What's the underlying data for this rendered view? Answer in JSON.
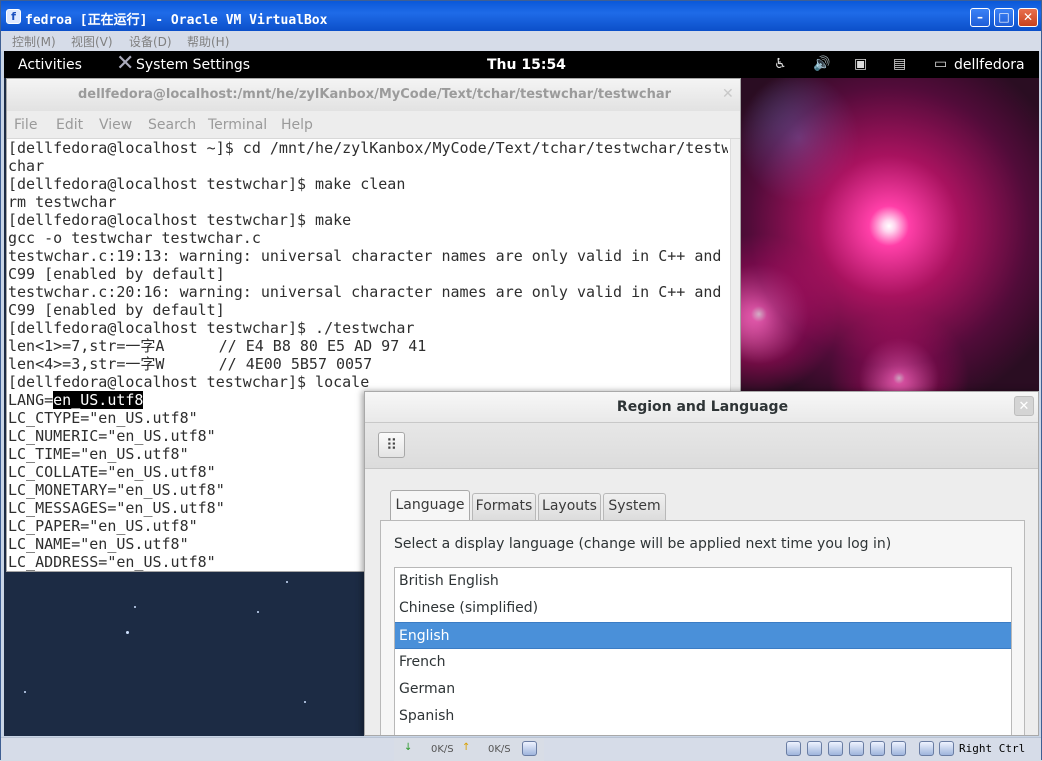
{
  "vbox": {
    "title": "fedroa [正在运行] - Oracle VM VirtualBox",
    "menu": [
      "控制(M)",
      "视图(V)",
      "设备(D)",
      "帮助(H)"
    ],
    "status": {
      "down_rate": "0K/S",
      "up_rate": "0K/S",
      "host_key": "Right Ctrl"
    }
  },
  "gnome": {
    "activities": "Activities",
    "app_menu": "System Settings",
    "clock": "Thu 15:54",
    "user": "dellfedora"
  },
  "terminal": {
    "title": "dellfedora@localhost:/mnt/he/zylKanbox/MyCode/Text/tchar/testwchar/testwchar",
    "menu": [
      "File",
      "Edit",
      "View",
      "Search",
      "Terminal",
      "Help"
    ],
    "lines": [
      "[dellfedora@localhost ~]$ cd /mnt/he/zylKanbox/MyCode/Text/tchar/testwchar/testw",
      "char",
      "[dellfedora@localhost testwchar]$ make clean",
      "rm testwchar",
      "[dellfedora@localhost testwchar]$ make",
      "gcc -o testwchar testwchar.c",
      "testwchar.c:19:13: warning: universal character names are only valid in C++ and",
      "C99 [enabled by default]",
      "testwchar.c:20:16: warning: universal character names are only valid in C++ and",
      "C99 [enabled by default]",
      "[dellfedora@localhost testwchar]$ ./testwchar",
      "len<1>=7,str=一字A      // E4 B8 80 E5 AD 97 41",
      "len<4>=3,str=一字W      // 4E00 5B57 0057",
      "[dellfedora@localhost testwchar]$ locale"
    ],
    "lang_prefix": "LANG=",
    "lang_value": "en_US.utf8",
    "locale_lines": [
      "LC_CTYPE=\"en_US.utf8\"",
      "LC_NUMERIC=\"en_US.utf8\"",
      "LC_TIME=\"en_US.utf8\"",
      "LC_COLLATE=\"en_US.utf8\"",
      "LC_MONETARY=\"en_US.utf8\"",
      "LC_MESSAGES=\"en_US.utf8\"",
      "LC_PAPER=\"en_US.utf8\"",
      "LC_NAME=\"en_US.utf8\"",
      "LC_ADDRESS=\"en_US.utf8\""
    ]
  },
  "region": {
    "title": "Region and Language",
    "tabs": [
      "Language",
      "Formats",
      "Layouts",
      "System"
    ],
    "active_tab": "Language",
    "hint": "Select a display language (change will be applied next time you log in)",
    "languages": [
      "British English",
      "Chinese (simplified)",
      "English",
      "French",
      "German",
      "Spanish"
    ],
    "selected_language": "English"
  },
  "colors": {
    "selection": "#4a90d9",
    "vbox_title": "#0a58d8"
  }
}
